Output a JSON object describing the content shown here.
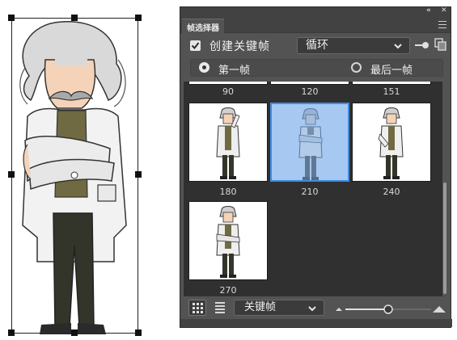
{
  "panel": {
    "tab_title": "帧选择器",
    "collapse_glyph": "«",
    "close_glyph": "✕",
    "menu_icon": "panel-menu-icon"
  },
  "options": {
    "create_keyframe_label": "创建关键帧",
    "create_keyframe_checked": true,
    "loop_dropdown_value": "循环"
  },
  "range": {
    "first_frame_label": "第一帧",
    "last_frame_label": "最后一帧",
    "selected": "first"
  },
  "frames": {
    "top_row_numbers": [
      "90",
      "120",
      "151"
    ],
    "cells": [
      {
        "number": "180",
        "selected": false
      },
      {
        "number": "210",
        "selected": true
      },
      {
        "number": "240",
        "selected": false
      },
      {
        "number": "270",
        "selected": false
      }
    ]
  },
  "bottom": {
    "filter_dropdown_value": "关键帧",
    "zoom_level": 0.5
  },
  "colors": {
    "panel_bg": "#535353",
    "grid_bg": "#303030",
    "selection_fill": "#a7c9f1",
    "selection_border": "#3d8de3"
  }
}
